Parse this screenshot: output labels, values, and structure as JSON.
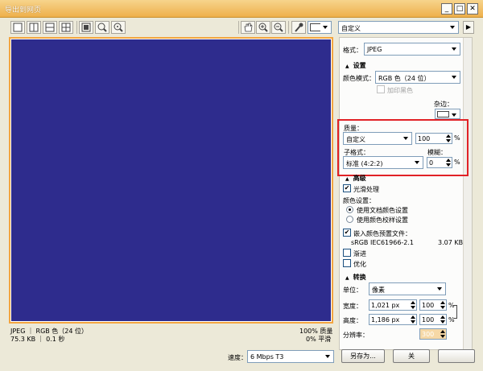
{
  "window": {
    "title": "导出到网页",
    "minimize": "_",
    "maximize": "□",
    "close": "✕"
  },
  "toolbar": {
    "preset_value": "自定义",
    "color_swatch": "#ffffff",
    "icons": [
      "single-view-icon",
      "split-vertical-icon",
      "split-horizontal-icon",
      "quad-view-icon",
      "zoom-fit-icon",
      "zoom-1to1-icon",
      "zoom-custom-icon",
      "hand-tool-icon",
      "zoom-in-icon",
      "zoom-out-icon",
      "eyedropper-icon"
    ]
  },
  "preview": {
    "canvas_color": "#2e2c8d",
    "border_color": "#f3a540"
  },
  "status": {
    "line1_left": "JPEG ｜ RGB 色（24 位）",
    "line2_left": "75.3 KB ｜ 0.1 秒",
    "line1_right": "100% 质量",
    "line2_right": "0% 平滑"
  },
  "panel": {
    "format_label": "格式：",
    "format_value": "JPEG",
    "settings_header": "设置",
    "color_mode_label": "颜色模式：",
    "color_mode_value": "RGB 色（24 位）",
    "add_black_label": "加印黑色",
    "matte_label": "杂边：",
    "quality_label": "质量：",
    "quality_preset": "自定义",
    "quality_value": "100",
    "quality_unit": "%",
    "subformat_label": "子格式：",
    "subformat_value": "标准 (4:2:2)",
    "blur_label": "模糊：",
    "blur_value": "0",
    "blur_unit": "%",
    "advanced_header": "高级",
    "smooth_label": "光滑处理",
    "color_settings_label": "颜色设置：",
    "radio_doc": "使用文档颜色设置",
    "radio_proof": "使用颜色校样设置",
    "embed_profile_label": "嵌入颜色预置文件：",
    "profile_name": "sRGB IEC61966-2.1",
    "profile_size": "3.07 KB",
    "progressive_label": "渐进",
    "optimize_label": "优化",
    "transform_header": "转换",
    "unit_label": "单位：",
    "unit_value": "像素",
    "width_label": "宽度：",
    "width_value": "1,021 px",
    "width_pct": "100",
    "height_label": "高度：",
    "height_value": "1,186 px",
    "height_pct": "100",
    "pct_unit": "%",
    "resolution_label": "分辨率：",
    "resolution_value": "300"
  },
  "bottom": {
    "speed_label": "速度：",
    "speed_value": "6 Mbps T3",
    "save_as_button": "另存为...",
    "close_button": "关"
  },
  "colors": {
    "highlight": "#e12226",
    "accent": "#f3a540"
  }
}
